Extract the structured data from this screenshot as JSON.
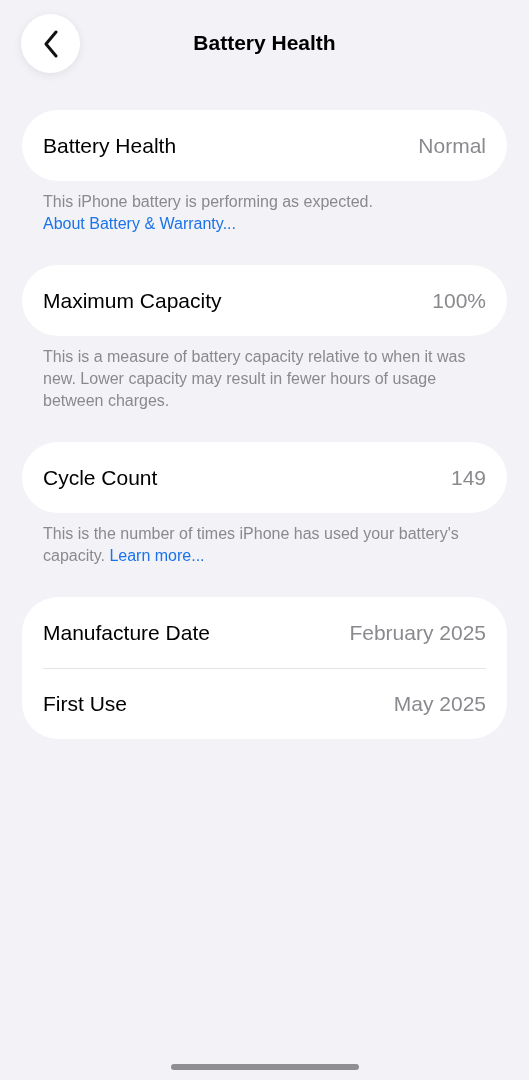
{
  "nav": {
    "title": "Battery Health"
  },
  "sections": [
    {
      "rows": [
        {
          "label": "Battery Health",
          "value": "Normal"
        }
      ],
      "footer": {
        "text": "This iPhone battery is performing as expected.",
        "link": "About Battery & Warranty..."
      }
    },
    {
      "rows": [
        {
          "label": "Maximum Capacity",
          "value": "100%"
        }
      ],
      "footer": {
        "text": "This is a measure of battery capacity relative to when it was new. Lower capacity may result in fewer hours of usage between charges."
      }
    },
    {
      "rows": [
        {
          "label": "Cycle Count",
          "value": "149"
        }
      ],
      "footer": {
        "text": "This is the number of times iPhone has used your battery's capacity.",
        "link": "Learn more..."
      }
    },
    {
      "rows": [
        {
          "label": "Manufacture Date",
          "value": "February 2025"
        },
        {
          "label": "First Use",
          "value": "May 2025"
        }
      ]
    }
  ]
}
